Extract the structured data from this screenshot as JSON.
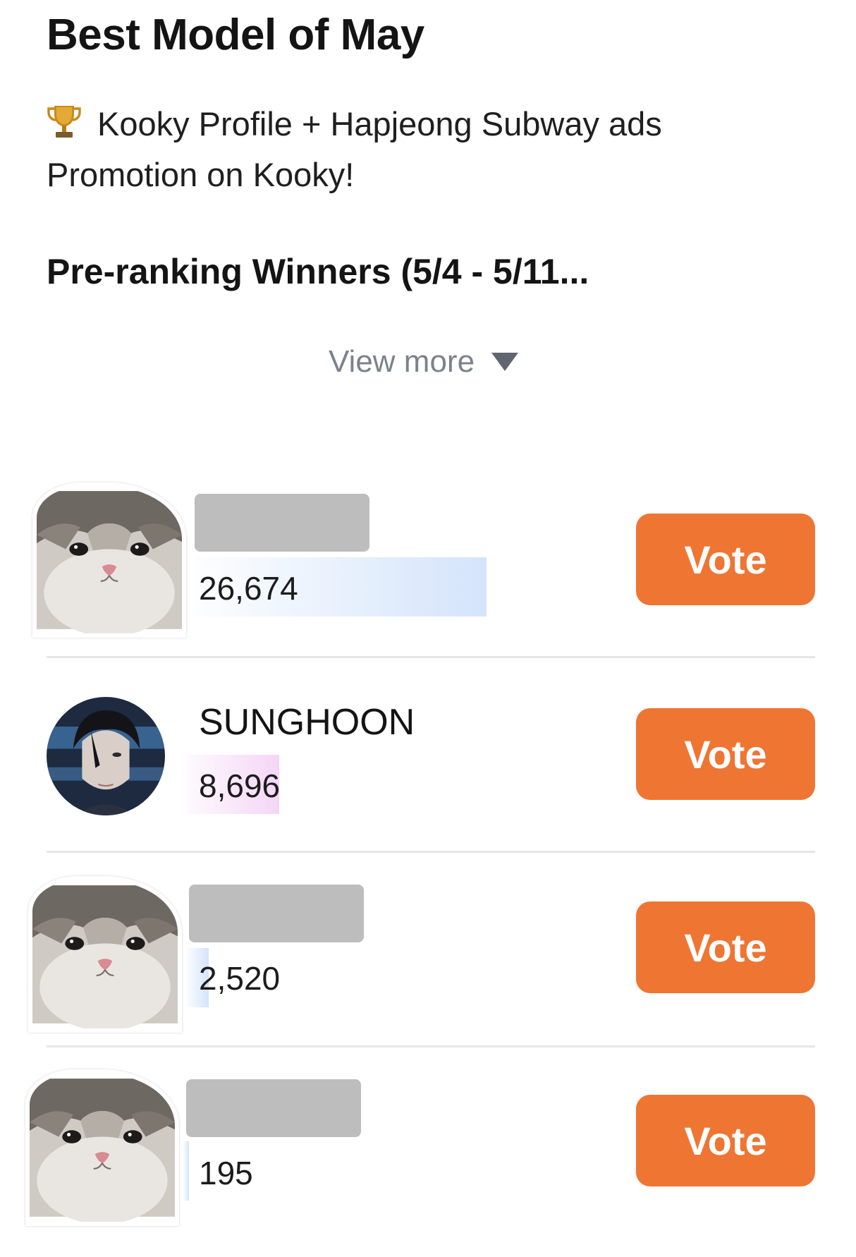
{
  "header": {
    "title": "Best Model of May",
    "promo_text": "Kooky Profile + Hapjeong Subway ads Promotion on Kooky!",
    "promo_icon": "trophy-icon",
    "subtitle": "Pre-ranking Winners (5/4 - 5/11...",
    "view_more_label": "View more",
    "view_more_icon": "triangle-down-icon"
  },
  "colors": {
    "vote_button": "#ef7533",
    "bar_blue": "#d4e4fb",
    "bar_pink": "#f4d6f6",
    "redacted_name": "#bdbdbd",
    "view_more_text": "#7c828c"
  },
  "ranking": {
    "vote_label": "Vote",
    "entries": [
      {
        "name": "",
        "name_redacted": true,
        "votes": "26,674",
        "avatar": "cat-sticker-avatar",
        "bar_color": "blue"
      },
      {
        "name": "SUNGHOON",
        "name_redacted": false,
        "votes": "8,696",
        "avatar": "sunghoon-avatar",
        "bar_color": "pink"
      },
      {
        "name": "",
        "name_redacted": true,
        "votes": "2,520",
        "avatar": "cat-sticker-avatar",
        "bar_color": "blue"
      },
      {
        "name": "",
        "name_redacted": true,
        "votes": "195",
        "avatar": "cat-sticker-avatar",
        "bar_color": "blue"
      }
    ]
  }
}
